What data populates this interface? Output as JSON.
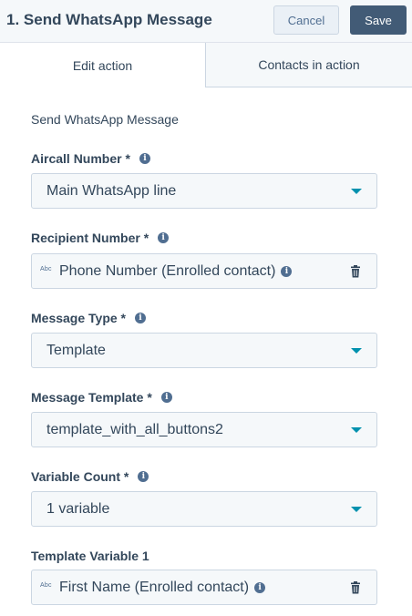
{
  "header": {
    "title": "1. Send WhatsApp Message",
    "cancel_label": "Cancel",
    "save_label": "Save"
  },
  "tabs": [
    {
      "label": "Edit action",
      "active": true
    },
    {
      "label": "Contacts in action",
      "active": false
    }
  ],
  "form": {
    "section_title": "Send WhatsApp Message",
    "aircall_number": {
      "label": "Aircall Number *",
      "value": "Main WhatsApp line",
      "icon": "info-icon"
    },
    "recipient_number": {
      "label": "Recipient Number *",
      "token_type": "Abc",
      "value": "Phone Number (Enrolled contact)",
      "icon": "info-icon"
    },
    "message_type": {
      "label": "Message Type *",
      "value": "Template",
      "icon": "info-icon"
    },
    "message_template": {
      "label": "Message Template *",
      "value": "template_with_all_buttons2",
      "icon": "info-icon"
    },
    "variable_count": {
      "label": "Variable Count *",
      "value": "1 variable",
      "icon": "info-icon"
    },
    "template_variable_1": {
      "label": "Template Variable 1",
      "token_type": "Abc",
      "value": "First Name (Enrolled contact)"
    }
  },
  "colors": {
    "header_bg": "#f5f8fa",
    "text": "#33475b",
    "save_bg": "#425b76",
    "caret": "#0091ae",
    "field_bg": "#f5f8fa",
    "border": "#cbd6e2"
  }
}
